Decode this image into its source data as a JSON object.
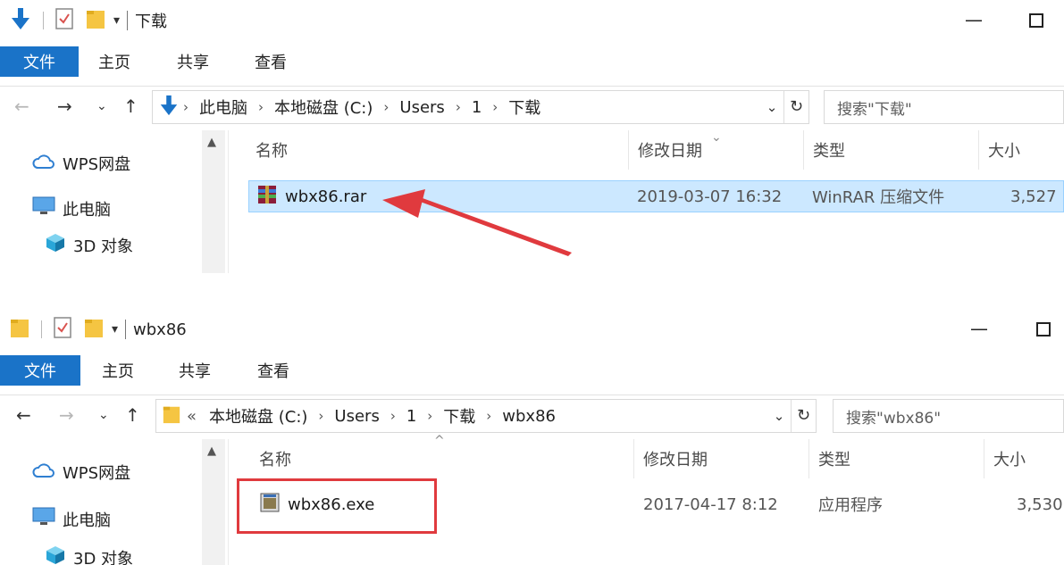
{
  "windows": [
    {
      "title": "下载",
      "ribbon_tabs": {
        "file": "文件",
        "home": "主页",
        "share": "共享",
        "view": "查看"
      },
      "breadcrumbs": [
        "此电脑",
        "本地磁盘 (C:)",
        "Users",
        "1",
        "下载"
      ],
      "search_placeholder": "搜索\"下载\"",
      "nav_items": [
        "WPS网盘",
        "此电脑",
        "3D 对象"
      ],
      "columns": {
        "name": "名称",
        "modified": "修改日期",
        "type": "类型",
        "size": "大小"
      },
      "files": [
        {
          "name": "wbx86.rar",
          "modified": "2019-03-07 16:32",
          "type": "WinRAR 压缩文件",
          "size": "3,527"
        }
      ]
    },
    {
      "title": "wbx86",
      "ribbon_tabs": {
        "file": "文件",
        "home": "主页",
        "share": "共享",
        "view": "查看"
      },
      "breadcrumbs": [
        "本地磁盘 (C:)",
        "Users",
        "1",
        "下载",
        "wbx86"
      ],
      "breadcrumb_overflow": "«",
      "search_placeholder": "搜索\"wbx86\"",
      "nav_items": [
        "WPS网盘",
        "此电脑",
        "3D 对象"
      ],
      "columns": {
        "name": "名称",
        "modified": "修改日期",
        "type": "类型",
        "size": "大小"
      },
      "files": [
        {
          "name": "wbx86.exe",
          "modified": "2017-04-17 8:12",
          "type": "应用程序",
          "size": "3,530"
        }
      ]
    }
  ],
  "colors": {
    "ribbon_file_tab": "#1a73c8",
    "selection": "#cce8ff",
    "annotation_red": "#e03a3e"
  },
  "icons": [
    "down-arrow-icon",
    "properties-icon",
    "folder-icon",
    "cloud-icon",
    "computer-icon",
    "cube-3d-icon",
    "rar-archive-icon",
    "exe-app-icon"
  ]
}
